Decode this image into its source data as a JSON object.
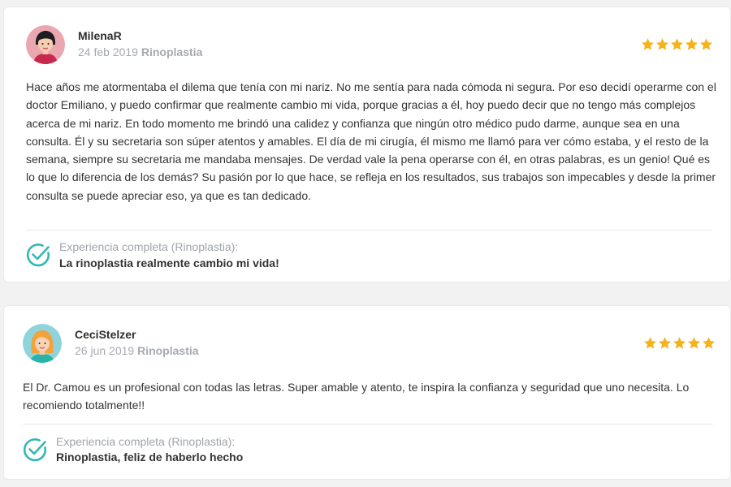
{
  "colors": {
    "star": "#f6b21b",
    "check": "#33b7b6",
    "muted_text": "#a5a9b0",
    "card_bg": "#ffffff"
  },
  "reviews": [
    {
      "author": "MilenaR",
      "date": "24 feb 2019",
      "procedure": "Rinoplastia",
      "rating": 5,
      "avatar_icon": "woman-dark-hair-avatar",
      "text": "Hace años me atormentaba el dilema que tenía con mi nariz. No me sentía para nada cómoda ni segura. Por eso decidí operarme con el doctor Emiliano, y puedo confirmar que realmente cambio mi vida, porque gracias a él, hoy puedo decir que no tengo más complejos acerca de mi nariz. En todo momento me brindó una calidez y confianza que ningún otro médico pudo darme, aunque sea en una consulta. Él y su secretaria son súper atentos y amables. El día de mi cirugía, él mismo me llamó para ver cómo estaba, y el resto de la semana, siempre su secretaria me mandaba mensajes. De verdad vale la pena operarse con él, en otras palabras, es un genio! Qué es lo que lo diferencia de los demás? Su pasión por lo que hace, se refleja en los resultados, sus trabajos son impecables y desde la primer consulta se puede apreciar eso, ya que es tan dedicado.",
      "experience_label": "Experiencia completa (Rinoplastia):",
      "experience_title": "La rinoplastia realmente cambio mi vida!"
    },
    {
      "author": "CeciStelzer",
      "date": "26 jun 2019",
      "procedure": "Rinoplastia",
      "rating": 5,
      "avatar_icon": "woman-blonde-hair-avatar",
      "text": "El Dr. Camou es un profesional con todas las letras. Super amable y atento, te inspira la confianza y seguridad que uno necesita. Lo recomiendo totalmente!!",
      "experience_label": "Experiencia completa (Rinoplastia):",
      "experience_title": "Rinoplastia, feliz de haberlo hecho"
    }
  ]
}
